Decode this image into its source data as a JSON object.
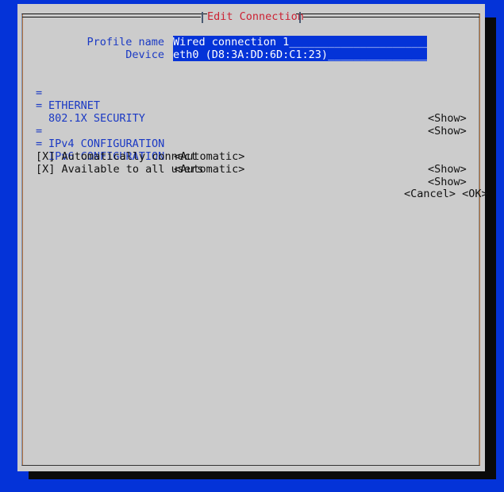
{
  "window": {
    "title": "Edit Connection",
    "title_color": "#cc2233",
    "background_color": "#0433d8",
    "surface_color": "#cccccc",
    "accent_color": "#1a39c4",
    "field_color": "#0433d8",
    "text_color": "#111111"
  },
  "form": {
    "fields": [
      {
        "label": "Profile name",
        "value": "Wired connection 1",
        "filler": "______________________",
        "name": "profile-name"
      },
      {
        "label": "Device",
        "value": "eth0 (D8:3A:DD:6D:C1:23)",
        "filler": "________________",
        "name": "device"
      }
    ]
  },
  "sections": [
    {
      "marker": "=",
      "label": "ETHERNET",
      "value": "",
      "action": "<Show>",
      "name": "ethernet"
    },
    {
      "marker": "=",
      "label": "802.1X SECURITY",
      "value": "",
      "action": "<Show>",
      "name": "802-1x-security"
    },
    {
      "marker": "=",
      "label": "IPv4 CONFIGURATION",
      "value": "<Automatic>",
      "action": "<Show>",
      "name": "ipv4-configuration"
    },
    {
      "marker": "=",
      "label": "IPv6 CONFIGURATION",
      "value": "<Automatic>",
      "action": "<Show>",
      "name": "ipv6-configuration"
    }
  ],
  "checkboxes": [
    {
      "text": "[X] Automatically connect",
      "name": "automatically-connect"
    },
    {
      "text": "[X] Available to all users",
      "name": "available-to-all-users"
    }
  ],
  "buttons": {
    "cancel": "<Cancel>",
    "ok": "<OK>",
    "separator": " "
  }
}
